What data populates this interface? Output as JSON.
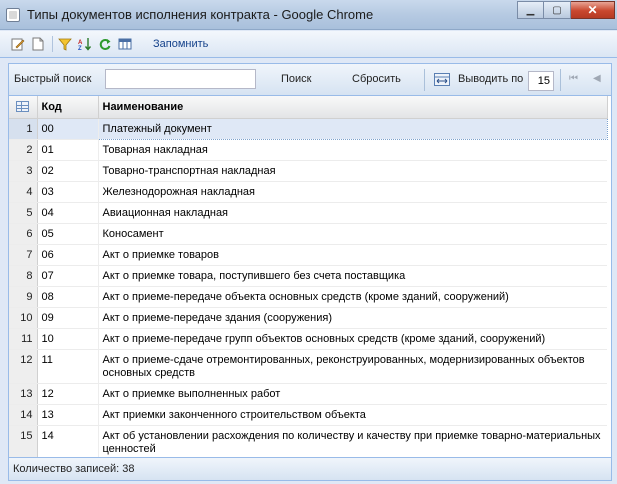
{
  "window": {
    "title": "Типы документов исполнения контракта - Google Chrome",
    "minimize": "▁",
    "maximize": "▢",
    "close": "✕"
  },
  "toolbar": {
    "icons": [
      "edit-icon",
      "new-document-icon",
      "filter-icon",
      "sort-icon",
      "refresh-icon",
      "columns-icon"
    ],
    "remember_label": "Запомнить"
  },
  "search": {
    "quick_search_label": "Быстрый поиск",
    "input_value": "",
    "search_button": "Поиск",
    "reset_button": "Сбросить",
    "show_label": "Выводить по",
    "page_size": "15"
  },
  "table": {
    "columns": [
      "Код",
      "Наименование"
    ],
    "rows": [
      {
        "n": "1",
        "code": "00",
        "name": "Платежный документ"
      },
      {
        "n": "2",
        "code": "01",
        "name": "Товарная накладная"
      },
      {
        "n": "3",
        "code": "02",
        "name": "Товарно-транспортная накладная"
      },
      {
        "n": "4",
        "code": "03",
        "name": "Железнодорожная накладная"
      },
      {
        "n": "5",
        "code": "04",
        "name": "Авиационная накладная"
      },
      {
        "n": "6",
        "code": "05",
        "name": "Коносамент"
      },
      {
        "n": "7",
        "code": "06",
        "name": "Акт о приемке товаров"
      },
      {
        "n": "8",
        "code": "07",
        "name": "Акт о приемке товара, поступившего без счета поставщика"
      },
      {
        "n": "9",
        "code": "08",
        "name": "Акт о приеме-передаче объекта основных средств (кроме зданий, сооружений)"
      },
      {
        "n": "10",
        "code": "09",
        "name": "Акт о приеме-передаче здания (сооружения)"
      },
      {
        "n": "11",
        "code": "10",
        "name": "Акт о приеме-передаче групп объектов основных средств (кроме зданий, сооружений)"
      },
      {
        "n": "12",
        "code": "11",
        "name": "Акт о приеме-сдаче отремонтированных, реконструированных, модернизированных объектов основных средств"
      },
      {
        "n": "13",
        "code": "12",
        "name": "Акт о приемке выполненных работ"
      },
      {
        "n": "14",
        "code": "13",
        "name": "Акт приемки законченного строительством объекта"
      },
      {
        "n": "15",
        "code": "14",
        "name": "Акт об установлении расхождения по количеству и качеству при приемке товарно-материальных ценностей"
      }
    ],
    "selected_row": 1
  },
  "status": {
    "records_text": "Количество записей: 38"
  },
  "colors": {
    "accent": "#99bbe8",
    "selection": "#dfe8f6",
    "close_button": "#c9472e"
  }
}
